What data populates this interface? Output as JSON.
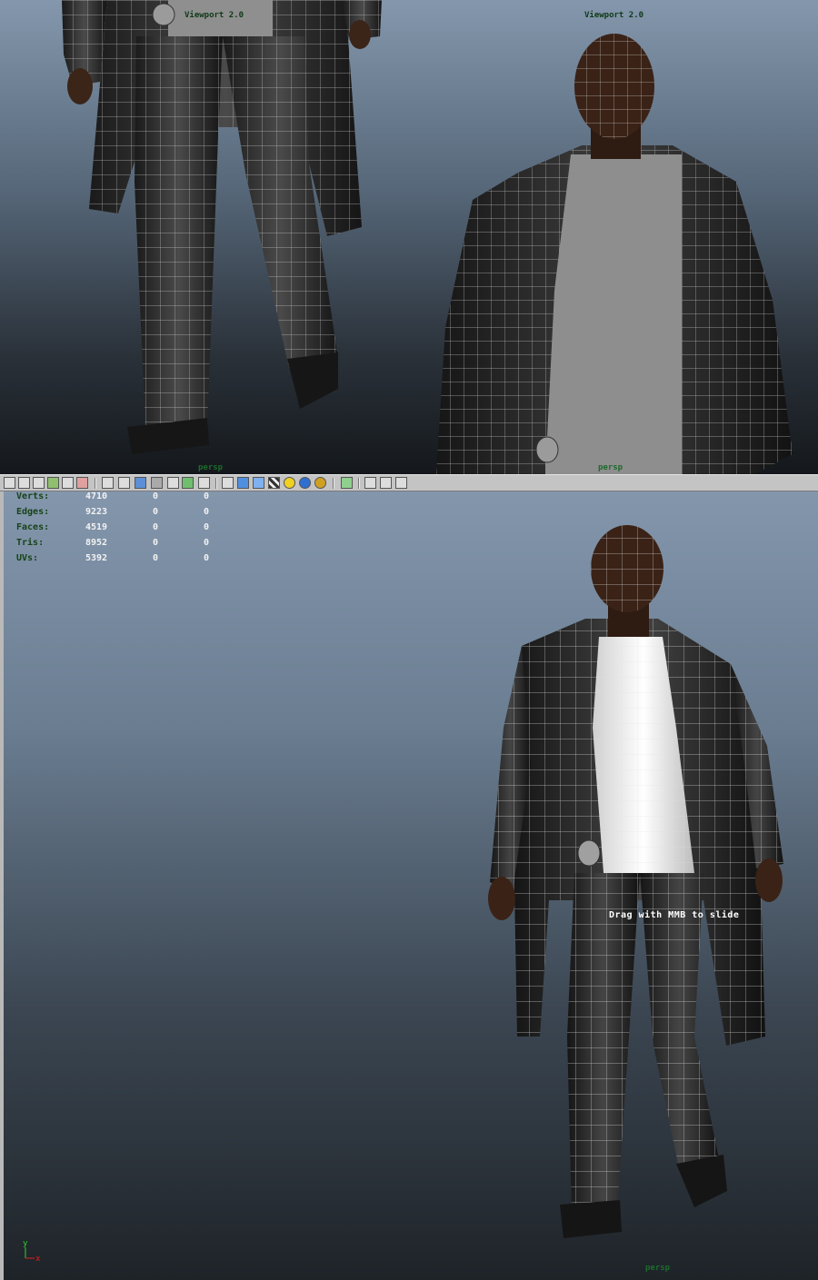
{
  "top_viewports": {
    "left": {
      "label": "Viewport 2.0",
      "camera": "persp"
    },
    "right": {
      "label": "Viewport 2.0",
      "camera": "persp"
    }
  },
  "toolbar": {
    "icons": [
      "select-camera-icon",
      "camera-attributes-icon",
      "bookmark-icon",
      "image-plane-icon",
      "grid-icon",
      "wireframe-icon",
      "smooth-shade-icon",
      "shade-all-icon",
      "flat-shade-icon",
      "xray-icon",
      "use-lights-icon",
      "textured-icon",
      "isolate-icon",
      "cube-blue-icon",
      "cube-lattice-icon",
      "checker-icon",
      "default-light-icon",
      "shadow-sphere-icon",
      "ambient-occlusion-icon",
      "select-region-icon",
      "two-pane-icon",
      "four-pane-icon",
      "share-icon"
    ]
  },
  "hud": {
    "rows": [
      {
        "label": "Verts:",
        "values": [
          "4710",
          "0",
          "0"
        ]
      },
      {
        "label": "Edges:",
        "values": [
          "9223",
          "0",
          "0"
        ]
      },
      {
        "label": "Faces:",
        "values": [
          "4519",
          "0",
          "0"
        ]
      },
      {
        "label": "Tris:",
        "values": [
          "8952",
          "0",
          "0"
        ]
      },
      {
        "label": "UVs:",
        "values": [
          "5392",
          "0",
          "0"
        ]
      }
    ]
  },
  "bottom_viewport": {
    "hint": "Drag with MMB to slide",
    "camera": "persp",
    "axis": {
      "y_label": "y",
      "x_label": "x",
      "y_color": "#2bd42b",
      "x_color": "#e02020"
    }
  },
  "colors": {
    "toolbar_bg": "#c4c4c4",
    "hud_label": "#164216",
    "hud_value": "#f2f2f2"
  }
}
